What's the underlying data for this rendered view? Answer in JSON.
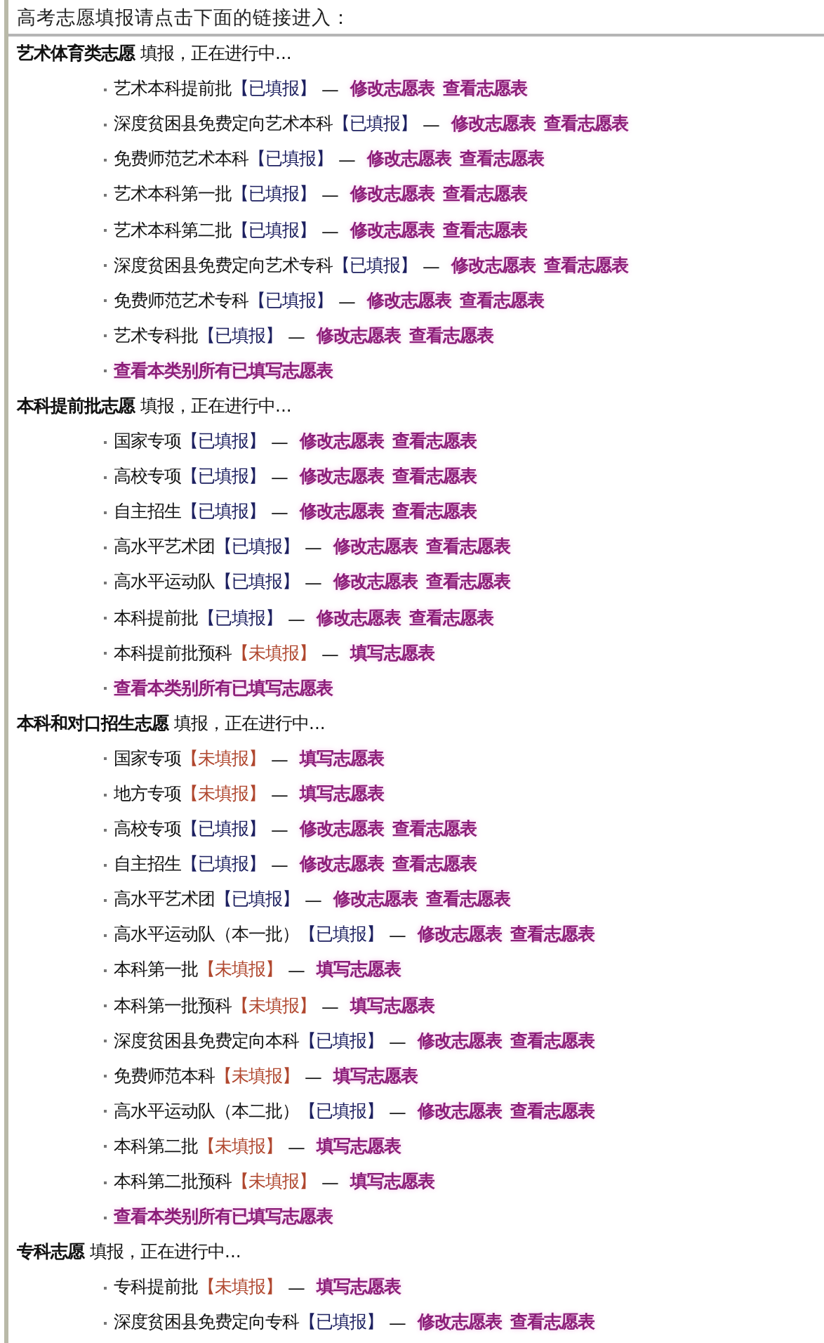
{
  "page_title": "高考志愿填报请点击下面的链接进入：",
  "sections": [
    {
      "title": "艺术体育类志愿",
      "status_text": "填报，正在进行中...",
      "items": [
        {
          "kind": "entry",
          "name": "艺术本科提前批",
          "status": "【已填报】",
          "filled": true,
          "dash": "—",
          "links": [
            "修改志愿表",
            "查看志愿表"
          ]
        },
        {
          "kind": "entry",
          "name": "深度贫困县免费定向艺术本科",
          "status": "【已填报】",
          "filled": true,
          "dash": "—",
          "links": [
            "修改志愿表",
            "查看志愿表"
          ]
        },
        {
          "kind": "entry",
          "name": "免费师范艺术本科",
          "status": "【已填报】",
          "filled": true,
          "dash": "—",
          "links": [
            "修改志愿表",
            "查看志愿表"
          ]
        },
        {
          "kind": "entry",
          "name": "艺术本科第一批",
          "status": "【已填报】",
          "filled": true,
          "dash": "—",
          "links": [
            "修改志愿表",
            "查看志愿表"
          ]
        },
        {
          "kind": "entry",
          "name": "艺术本科第二批",
          "status": "【已填报】",
          "filled": true,
          "dash": "—",
          "links": [
            "修改志愿表",
            "查看志愿表"
          ]
        },
        {
          "kind": "entry",
          "name": "深度贫困县免费定向艺术专科",
          "status": "【已填报】",
          "filled": true,
          "dash": "—",
          "links": [
            "修改志愿表",
            "查看志愿表"
          ]
        },
        {
          "kind": "entry",
          "name": "免费师范艺术专科",
          "status": "【已填报】",
          "filled": true,
          "dash": "—",
          "links": [
            "修改志愿表",
            "查看志愿表"
          ]
        },
        {
          "kind": "entry",
          "name": "艺术专科批",
          "status": "【已填报】",
          "filled": true,
          "dash": "—",
          "links": [
            "修改志愿表",
            "查看志愿表"
          ]
        },
        {
          "kind": "summary",
          "label": "查看本类别所有已填写志愿表"
        }
      ]
    },
    {
      "title": "本科提前批志愿",
      "status_text": "填报，正在进行中...",
      "items": [
        {
          "kind": "entry",
          "name": "国家专项",
          "status": "【已填报】",
          "filled": true,
          "dash": "—",
          "links": [
            "修改志愿表",
            "查看志愿表"
          ]
        },
        {
          "kind": "entry",
          "name": "高校专项",
          "status": "【已填报】",
          "filled": true,
          "dash": "—",
          "links": [
            "修改志愿表",
            "查看志愿表"
          ]
        },
        {
          "kind": "entry",
          "name": "自主招生",
          "status": "【已填报】",
          "filled": true,
          "dash": "—",
          "links": [
            "修改志愿表",
            "查看志愿表"
          ]
        },
        {
          "kind": "entry",
          "name": "高水平艺术团",
          "status": "【已填报】",
          "filled": true,
          "dash": "—",
          "links": [
            "修改志愿表",
            "查看志愿表"
          ]
        },
        {
          "kind": "entry",
          "name": "高水平运动队",
          "status": "【已填报】",
          "filled": true,
          "dash": "—",
          "links": [
            "修改志愿表",
            "查看志愿表"
          ]
        },
        {
          "kind": "entry",
          "name": "本科提前批",
          "status": "【已填报】",
          "filled": true,
          "dash": "—",
          "links": [
            "修改志愿表",
            "查看志愿表"
          ]
        },
        {
          "kind": "entry",
          "name": "本科提前批预科",
          "status": "【未填报】",
          "filled": false,
          "dash": "—",
          "links": [
            "填写志愿表"
          ]
        },
        {
          "kind": "summary",
          "label": "查看本类别所有已填写志愿表"
        }
      ]
    },
    {
      "title": "本科和对口招生志愿",
      "status_text": "填报，正在进行中...",
      "items": [
        {
          "kind": "entry",
          "name": "国家专项",
          "status": "【未填报】",
          "filled": false,
          "dash": "—",
          "links": [
            "填写志愿表"
          ]
        },
        {
          "kind": "entry",
          "name": "地方专项",
          "status": "【未填报】",
          "filled": false,
          "dash": "—",
          "links": [
            "填写志愿表"
          ]
        },
        {
          "kind": "entry",
          "name": "高校专项",
          "status": "【已填报】",
          "filled": true,
          "dash": "—",
          "links": [
            "修改志愿表",
            "查看志愿表"
          ]
        },
        {
          "kind": "entry",
          "name": "自主招生",
          "status": "【已填报】",
          "filled": true,
          "dash": "—",
          "links": [
            "修改志愿表",
            "查看志愿表"
          ]
        },
        {
          "kind": "entry",
          "name": "高水平艺术团",
          "status": "【已填报】",
          "filled": true,
          "dash": "—",
          "links": [
            "修改志愿表",
            "查看志愿表"
          ]
        },
        {
          "kind": "entry",
          "name": "高水平运动队（本一批）",
          "status": "【已填报】",
          "filled": true,
          "dash": "—",
          "links": [
            "修改志愿表",
            "查看志愿表"
          ]
        },
        {
          "kind": "entry",
          "name": "本科第一批",
          "status": "【未填报】",
          "filled": false,
          "dash": "—",
          "links": [
            "填写志愿表"
          ]
        },
        {
          "kind": "entry",
          "name": "本科第一批预科",
          "status": "【未填报】",
          "filled": false,
          "dash": "—",
          "links": [
            "填写志愿表"
          ]
        },
        {
          "kind": "entry",
          "name": "深度贫困县免费定向本科",
          "status": "【已填报】",
          "filled": true,
          "dash": "—",
          "links": [
            "修改志愿表",
            "查看志愿表"
          ]
        },
        {
          "kind": "entry",
          "name": "免费师范本科",
          "status": "【未填报】",
          "filled": false,
          "dash": "—",
          "links": [
            "填写志愿表"
          ]
        },
        {
          "kind": "entry",
          "name": "高水平运动队（本二批）",
          "status": "【已填报】",
          "filled": true,
          "dash": "—",
          "links": [
            "修改志愿表",
            "查看志愿表"
          ]
        },
        {
          "kind": "entry",
          "name": "本科第二批",
          "status": "【未填报】",
          "filled": false,
          "dash": "—",
          "links": [
            "填写志愿表"
          ]
        },
        {
          "kind": "entry",
          "name": "本科第二批预科",
          "status": "【未填报】",
          "filled": false,
          "dash": "—",
          "links": [
            "填写志愿表"
          ]
        },
        {
          "kind": "summary",
          "label": "查看本类别所有已填写志愿表"
        }
      ]
    },
    {
      "title": "专科志愿",
      "status_text": "填报，正在进行中...",
      "items": [
        {
          "kind": "entry",
          "name": "专科提前批",
          "status": "【未填报】",
          "filled": false,
          "dash": "—",
          "links": [
            "填写志愿表"
          ]
        },
        {
          "kind": "entry",
          "name": "深度贫困县免费定向专科",
          "status": "【已填报】",
          "filled": true,
          "dash": "—",
          "links": [
            "修改志愿表",
            "查看志愿表"
          ]
        }
      ]
    }
  ]
}
